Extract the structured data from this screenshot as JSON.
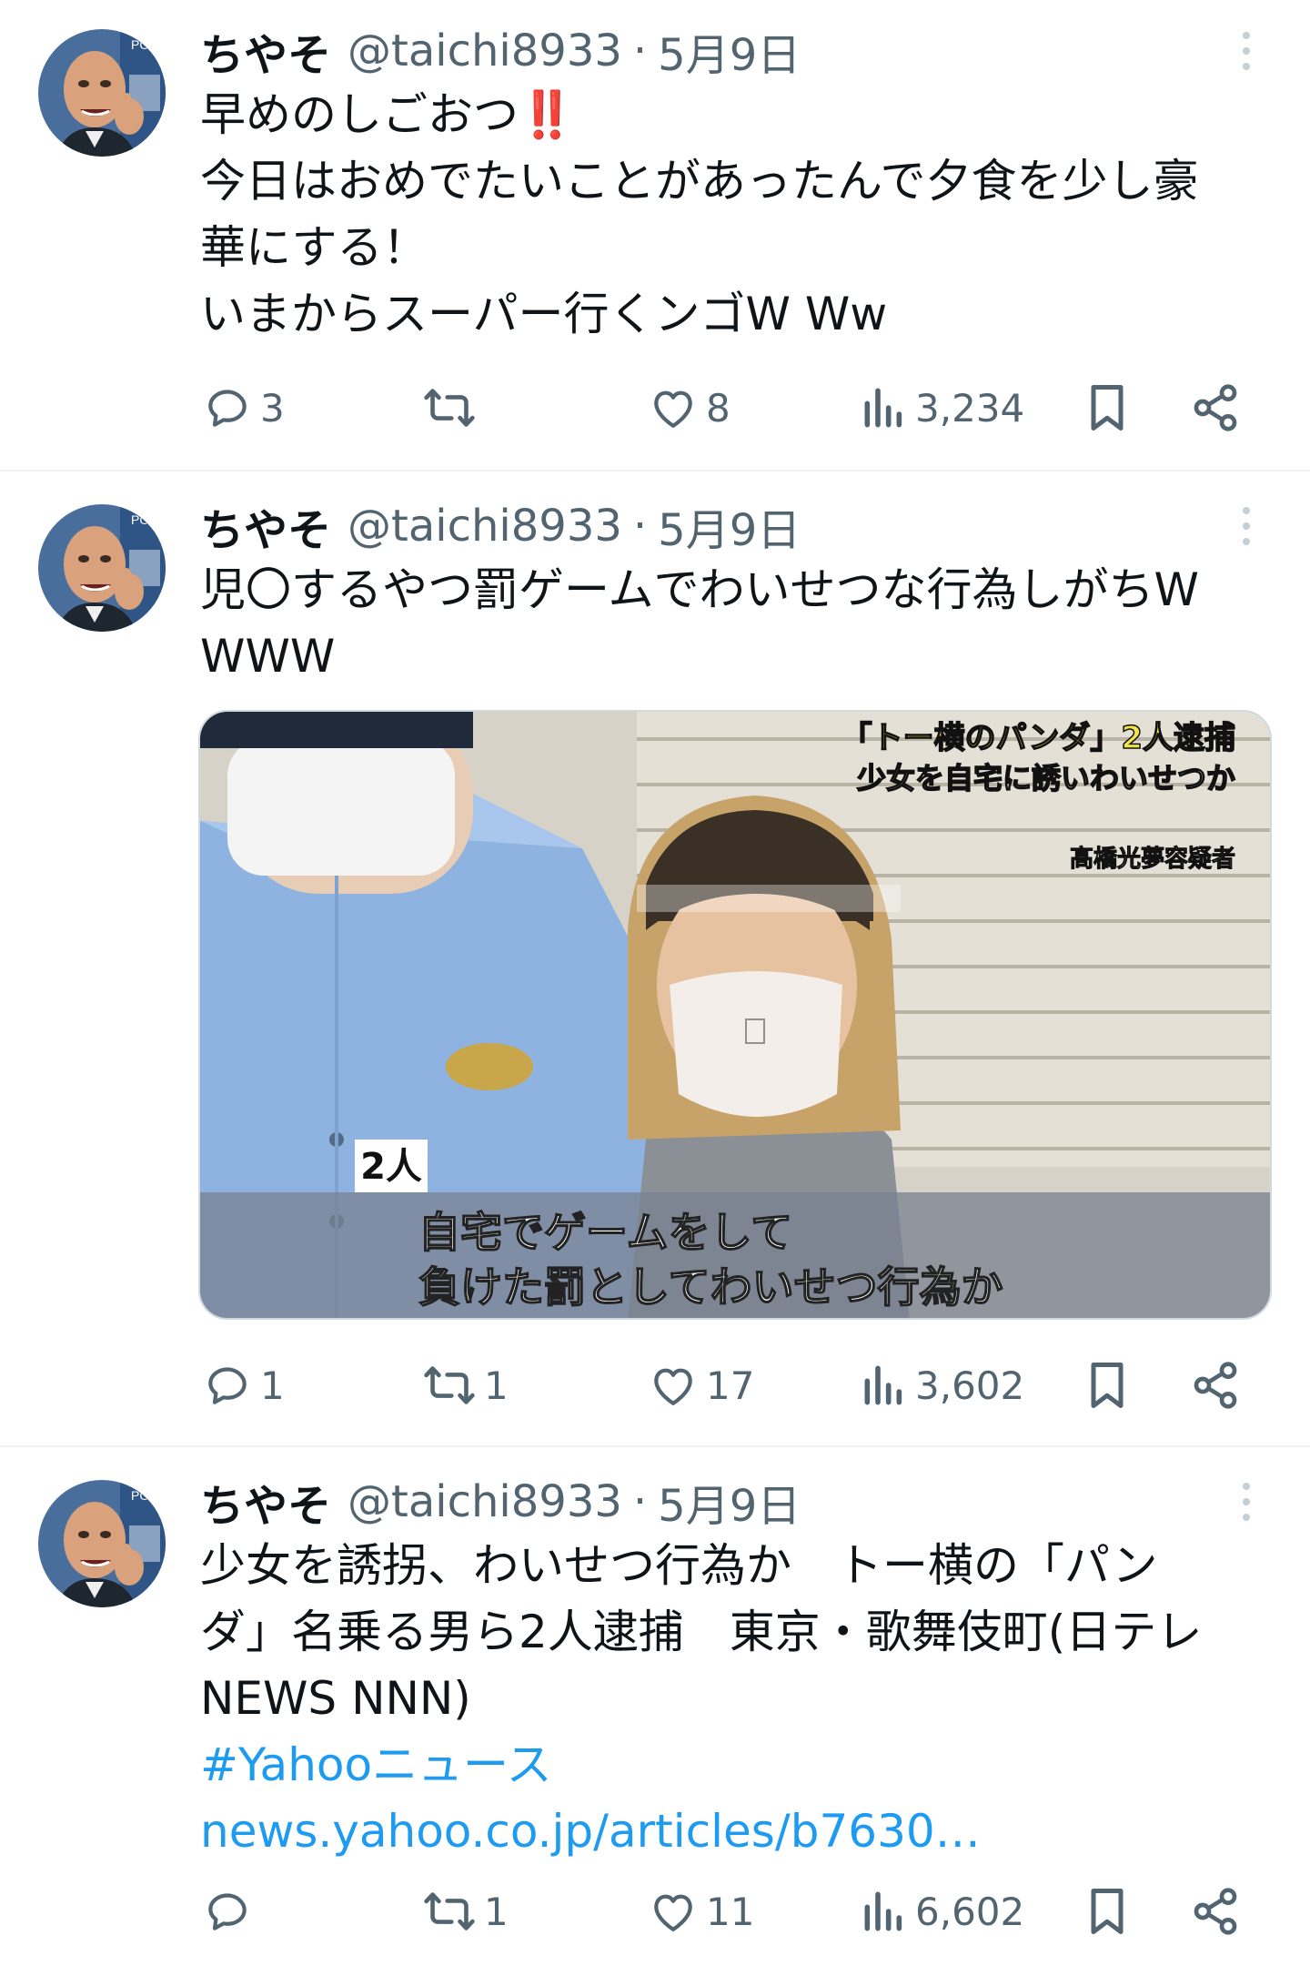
{
  "tweets": [
    {
      "name": "ちやそ",
      "handle": "@taichi8933",
      "date": "5月9日",
      "lines": [
        "早めのしごおつ",
        "今日はおめでたいことがあったんで夕食を少し豪",
        "華にする！",
        "いまからスーパー行くンゴW Ww"
      ],
      "emoji": "‼️",
      "replies": "3",
      "retweets": "",
      "likes": "8",
      "views": "3,234"
    },
    {
      "name": "ちやそ",
      "handle": "@taichi8933",
      "date": "5月9日",
      "lines": [
        "児〇するやつ罰ゲームでわいせつな行為しがちW",
        "WWW"
      ],
      "replies": "1",
      "retweets": "1",
      "likes": "17",
      "views": "3,602",
      "media": {
        "caption_title": "「トー横のパンダ」2人逮捕",
        "caption_sub": "少女を自宅に誘いわいせつか",
        "caption_name": "髙橋光夢容疑者",
        "badge": "2人",
        "subtitle_1": "自宅でゲームをして",
        "subtitle_2": "負けた罰としてわいせつ行為か"
      }
    },
    {
      "name": "ちやそ",
      "handle": "@taichi8933",
      "date": "5月9日",
      "lines": [
        "少女を誘拐、わいせつ行為か　トー横の「パン",
        "ダ」名乗る男ら2人逮捕　東京・歌舞伎町(日テレ",
        "NEWS NNN)"
      ],
      "hashtag": "#Yahooニュース",
      "url": "news.yahoo.co.jp/articles/b7630…",
      "replies": "",
      "retweets": "1",
      "likes": "11",
      "views": "6,602"
    }
  ],
  "separator": "·",
  "icons": {
    "reply": "reply-icon",
    "retweet": "retweet-icon",
    "like": "heart-icon",
    "views": "views-icon",
    "bookmark": "bookmark-icon",
    "share": "share-icon",
    "more": "more-icon"
  },
  "colors": {
    "link": "#1d9bf0",
    "secondary": "#536471",
    "text": "#0f1419",
    "divider": "#eff3f4"
  }
}
